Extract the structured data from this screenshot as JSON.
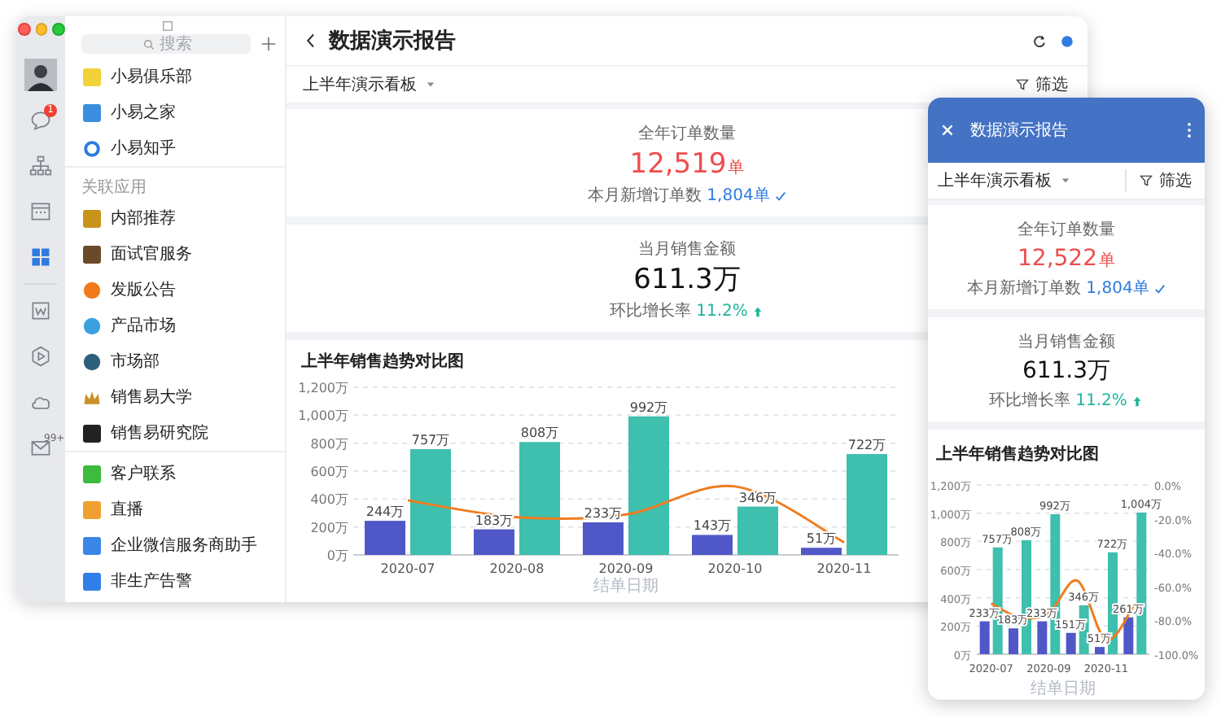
{
  "window": {
    "controls": [
      {
        "kind": "close",
        "color": "#fe5f57"
      },
      {
        "kind": "minimize",
        "color": "#febc2e"
      },
      {
        "kind": "zoom",
        "color": "#28c840"
      }
    ]
  },
  "rail": {
    "top": [
      {
        "kind": "avatar",
        "selected": false
      },
      {
        "kind": "chat",
        "badge": "1",
        "selected": false
      },
      {
        "kind": "org",
        "selected": false
      },
      {
        "kind": "calendar",
        "selected": false
      },
      {
        "kind": "apps",
        "selected": true
      }
    ],
    "bottom": [
      {
        "kind": "doc",
        "selected": false
      },
      {
        "kind": "hexagon",
        "selected": false
      },
      {
        "kind": "cloud",
        "selected": false
      },
      {
        "kind": "mail",
        "badge": "99+",
        "selected": false
      }
    ]
  },
  "sidebar": {
    "search": {
      "placeholder": "搜索"
    },
    "groups": [
      {
        "items": [
          {
            "label": "小易俱乐部",
            "kind": "tile",
            "color": "#f2d13a"
          },
          {
            "label": "小易之家",
            "kind": "tile",
            "color": "#3b8ee0"
          },
          {
            "label": "小易知乎",
            "kind": "ring",
            "color": "#2f7be0"
          }
        ]
      },
      {
        "heading": "关联应用",
        "items": [
          {
            "label": "内部推荐",
            "kind": "tile",
            "color": "#c8931a"
          },
          {
            "label": "面试官服务",
            "kind": "tile",
            "color": "#6b4a2a"
          },
          {
            "label": "发版公告",
            "kind": "circle",
            "color": "#f07a1a"
          },
          {
            "label": "产品市场",
            "kind": "circle",
            "color": "#3aa0e0"
          },
          {
            "label": "市场部",
            "kind": "circle",
            "color": "#2c5f7a"
          },
          {
            "label": "销售易大学",
            "kind": "crown",
            "color": "#c9902a"
          },
          {
            "label": "销售易研究院",
            "kind": "tile",
            "color": "#222222"
          }
        ]
      },
      {
        "items": [
          {
            "label": "客户联系",
            "kind": "tile",
            "color": "#3dbb3d"
          },
          {
            "label": "直播",
            "kind": "tile",
            "color": "#f0a030"
          },
          {
            "label": "企业微信服务商助手",
            "kind": "tile",
            "color": "#3a86e8"
          },
          {
            "label": "非生产告警",
            "kind": "tile",
            "color": "#2f7fe8"
          }
        ]
      }
    ]
  },
  "main": {
    "title": "数据演示报告",
    "board": "上半年演示看板",
    "filter": "筛选",
    "cards": [
      {
        "kind": "count",
        "label": "全年订单数量",
        "value": "12,519",
        "unit": "单",
        "note": "本月新增订单数",
        "note_value": "1,804单"
      },
      {
        "kind": "amount",
        "label": "当月销售金额",
        "value": "611.3万",
        "note": "环比增长率",
        "note_value": "11.2%"
      }
    ],
    "chart_data": {
      "type": "bar",
      "title": "上半年销售趋势对比图",
      "xlabel": "结单日期",
      "grid": true,
      "categories": [
        "2020-07",
        "2020-08",
        "2020-09",
        "2020-10",
        "2020-11"
      ],
      "ylim": [
        0,
        1200
      ],
      "yticks": [
        {
          "value": 0,
          "label": "0万"
        },
        {
          "value": 200,
          "label": "200万"
        },
        {
          "value": 400,
          "label": "400万"
        },
        {
          "value": 600,
          "label": "600万"
        },
        {
          "value": 800,
          "label": "800万"
        },
        {
          "value": 1000,
          "label": "1,000万"
        },
        {
          "value": 1200,
          "label": "1,200万"
        }
      ],
      "series": [
        {
          "type": "bar",
          "color": "#5058c8",
          "values": [
            244,
            183,
            233,
            143,
            51
          ],
          "value_labels": [
            "244万",
            "183万",
            "233万",
            "143万",
            "51万"
          ]
        },
        {
          "type": "bar",
          "color": "#3fbfad",
          "values": [
            757,
            808,
            992,
            346,
            722
          ],
          "value_labels": [
            "757万",
            "808万",
            "992万",
            "346万",
            "722万"
          ]
        },
        {
          "type": "line",
          "color": "#f07c1e",
          "values": [
            390,
            270,
            290,
            490,
            90
          ]
        }
      ]
    }
  },
  "mobile": {
    "title": "数据演示报告",
    "board": "上半年演示看板",
    "filter": "筛选",
    "cards": [
      {
        "kind": "count",
        "label": "全年订单数量",
        "value": "12,522",
        "unit": "单",
        "note": "本月新增订单数",
        "note_value": "1,804单"
      },
      {
        "kind": "amount",
        "label": "当月销售金额",
        "value": "611.3万",
        "note": "环比增长率",
        "note_value": "11.2%"
      }
    ],
    "chart_data": {
      "type": "bar",
      "title": "上半年销售趋势对比图",
      "xlabel": "结单日期",
      "grid": true,
      "categories": [
        "2020-07",
        null,
        "2020-09",
        null,
        "2020-11",
        null
      ],
      "ylim": [
        0,
        1200
      ],
      "y2lim": [
        -100,
        0
      ],
      "yticks": [
        {
          "value": 0,
          "label": "0万"
        },
        {
          "value": 200,
          "label": "200万"
        },
        {
          "value": 400,
          "label": "400万"
        },
        {
          "value": 600,
          "label": "600万"
        },
        {
          "value": 800,
          "label": "800万"
        },
        {
          "value": 1000,
          "label": "1,000万"
        },
        {
          "value": 1200,
          "label": "1,200万"
        }
      ],
      "y2ticks": [
        {
          "value": 0,
          "label": "0.0%"
        },
        {
          "value": -20,
          "label": "-20.0%"
        },
        {
          "value": -40,
          "label": "-40.0%"
        },
        {
          "value": -60,
          "label": "-60.0%"
        },
        {
          "value": -80,
          "label": "-80.0%"
        },
        {
          "value": -100,
          "label": "-100.0%"
        }
      ],
      "series": [
        {
          "type": "bar",
          "color": "#5058c8",
          "values": [
            233,
            183,
            233,
            151,
            51,
            261
          ],
          "value_labels": [
            "233万",
            "183万",
            "233万",
            "151万",
            "51万",
            "261万"
          ]
        },
        {
          "type": "bar",
          "color": "#3fbfad",
          "values": [
            757,
            808,
            992,
            346,
            722,
            1004
          ],
          "value_labels": [
            "757万",
            "808万",
            "992万",
            "346万",
            "722万",
            "1,004万"
          ]
        },
        {
          "type": "line",
          "color": "#f07c1e",
          "values": [
            360,
            260,
            290,
            520,
            100,
            360
          ]
        }
      ]
    }
  }
}
